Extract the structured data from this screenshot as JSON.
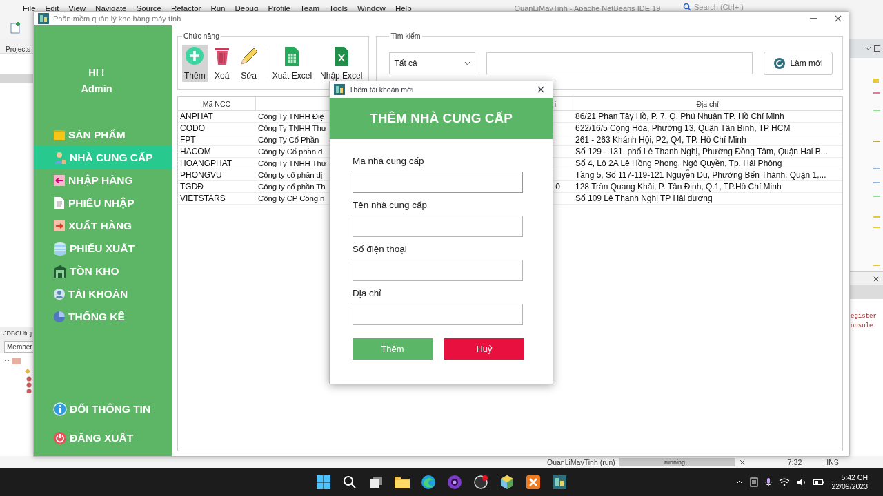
{
  "ide": {
    "menu": [
      "File",
      "Edit",
      "View",
      "Navigate",
      "Source",
      "Refactor",
      "Run",
      "Debug",
      "Profile",
      "Team",
      "Tools",
      "Window",
      "Help"
    ],
    "title": "QuanLiMayTinh - Apache NetBeans IDE 19",
    "search": {
      "placeholder": "Search (Ctrl+I)"
    },
    "left_panel": {
      "tab": "Projects",
      "file_tab": "JDBCUtil.j",
      "members": "Member"
    },
    "output_lines": [
      "egister",
      "onsole"
    ],
    "status_bar": {
      "project": "QuanLiMayTinh (run)",
      "task": "running...",
      "level": 1,
      "position": "7:32",
      "mode": "INS"
    }
  },
  "app": {
    "title": "Phần mềm quản lý kho hàng máy tính",
    "sidebar": {
      "greeting": "HI !",
      "user": "Admin",
      "items": [
        {
          "label": "SẢN PHẨM",
          "selected": false
        },
        {
          "label": "NHÀ CUNG CẤP",
          "selected": true
        },
        {
          "label": "NHẬP HÀNG",
          "selected": false
        },
        {
          "label": "PHIẾU NHẬP",
          "selected": false
        },
        {
          "label": "XUẤT HÀNG",
          "selected": false
        },
        {
          "label": "PHIẾU XUẤT",
          "selected": false
        },
        {
          "label": "TỒN KHO",
          "selected": false
        },
        {
          "label": "TÀI KHOẢN",
          "selected": false
        },
        {
          "label": "THỐNG KÊ",
          "selected": false
        }
      ],
      "bottom_items": [
        {
          "label": "ĐỔI THÔNG TIN"
        },
        {
          "label": "ĐĂNG XUẤT"
        }
      ]
    },
    "actions": {
      "title": "Chức năng",
      "buttons": [
        {
          "label": "Thêm",
          "selected": true
        },
        {
          "label": "Xoá",
          "selected": false
        },
        {
          "label": "Sửa",
          "selected": false
        },
        {
          "label": "Xuất Excel",
          "selected": false
        },
        {
          "label": "Nhập Excel",
          "selected": false
        }
      ]
    },
    "search": {
      "title": "Tìm kiếm",
      "filter": "Tất cả",
      "refresh": "Làm mới"
    },
    "table": {
      "columns": {
        "code": "Mã NCC",
        "column_3": "i",
        "address": "Địa chỉ"
      },
      "rows": [
        {
          "code": "ANPHAT",
          "name": "Công Ty TNHH Điệ",
          "address": "86/21 Phan Tây Hồ, P. 7, Q. Phú Nhuận TP. Hồ Chí Minh"
        },
        {
          "code": "CODO",
          "name": "Công Ty TNHH Thư",
          "address": "622/16/5 Cộng Hòa, Phường 13, Quận Tân Bình, TP HCM"
        },
        {
          "code": "FPT",
          "name": "Công Ty Cổ Phần",
          "address": "261 - 263 Khánh Hội, P2, Q4, TP. Hồ Chí Minh"
        },
        {
          "code": "HACOM",
          "name": "Công ty Cổ phần đ",
          "address": "Số 129 - 131, phố Lê Thanh Nghị, Phường Đồng Tâm, Quận Hai B..."
        },
        {
          "code": "HOANGPHAT",
          "name": "Công Ty TNHH Thư",
          "address": "Số 4, Lô 2A Lê Hồng Phong, Ngô Quyền, Tp. Hải Phòng"
        },
        {
          "code": "PHONGVU",
          "name": "Công ty cổ phần dị",
          "address": "Tầng 5, Số 117-119-121 Nguyễn Du, Phường Bến Thành, Quận 1,..."
        },
        {
          "code": "TGDĐ",
          "name": "Công ty cổ phần Th",
          "column_3": "0",
          "address": "128 Trần Quang Khải, P. Tân Định, Q.1, TP.Hồ Chí Minh"
        },
        {
          "code": "VIETSTARS",
          "name": "Công ty CP Công n",
          "address": " Số 109 Lê Thanh Nghị  TP Hải dương"
        }
      ]
    }
  },
  "dialog": {
    "title": "Thêm tài khoản mới",
    "heading": "THÊM NHÀ CUNG CẤP",
    "fields": [
      {
        "label": "Mã nhà cung cấp",
        "focused": true
      },
      {
        "label": "Tên nhà cung cấp",
        "focused": false
      },
      {
        "label": "Số điện thoại",
        "focused": false
      },
      {
        "label": "Địa chỉ",
        "focused": false
      }
    ],
    "buttons": [
      {
        "label": "Thêm",
        "kind": "confirm"
      },
      {
        "label": "Huỷ",
        "kind": "cancel"
      }
    ]
  },
  "taskbar": {
    "time": "5:42 CH",
    "date": "22/09/2023"
  }
}
